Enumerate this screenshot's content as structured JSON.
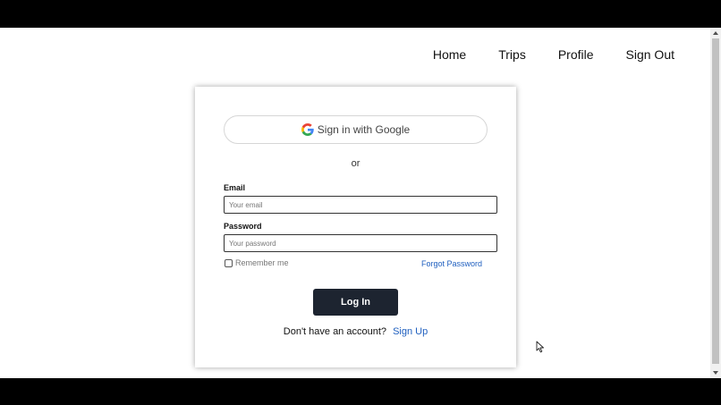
{
  "nav": {
    "items": [
      {
        "label": "Home"
      },
      {
        "label": "Trips"
      },
      {
        "label": "Profile"
      },
      {
        "label": "Sign Out"
      }
    ]
  },
  "login": {
    "google_button": {
      "label": "Sign in with Google",
      "icon": "google-icon"
    },
    "separator": "or",
    "email": {
      "label": "Email",
      "placeholder": "Your email",
      "value": ""
    },
    "password": {
      "label": "Password",
      "placeholder": "Your password",
      "value": ""
    },
    "remember_me": {
      "label": "Remember me",
      "checked": false
    },
    "forgot_password": "Forgot Password",
    "submit_label": "Log In",
    "signup_prompt": "Don't have an account?",
    "signup_link": "Sign Up"
  },
  "colors": {
    "button_bg": "#1d2430",
    "link": "#1f5fbf",
    "google_blue": "#4285F4",
    "google_red": "#EA4335",
    "google_yellow": "#FBBC05",
    "google_green": "#34A853"
  }
}
